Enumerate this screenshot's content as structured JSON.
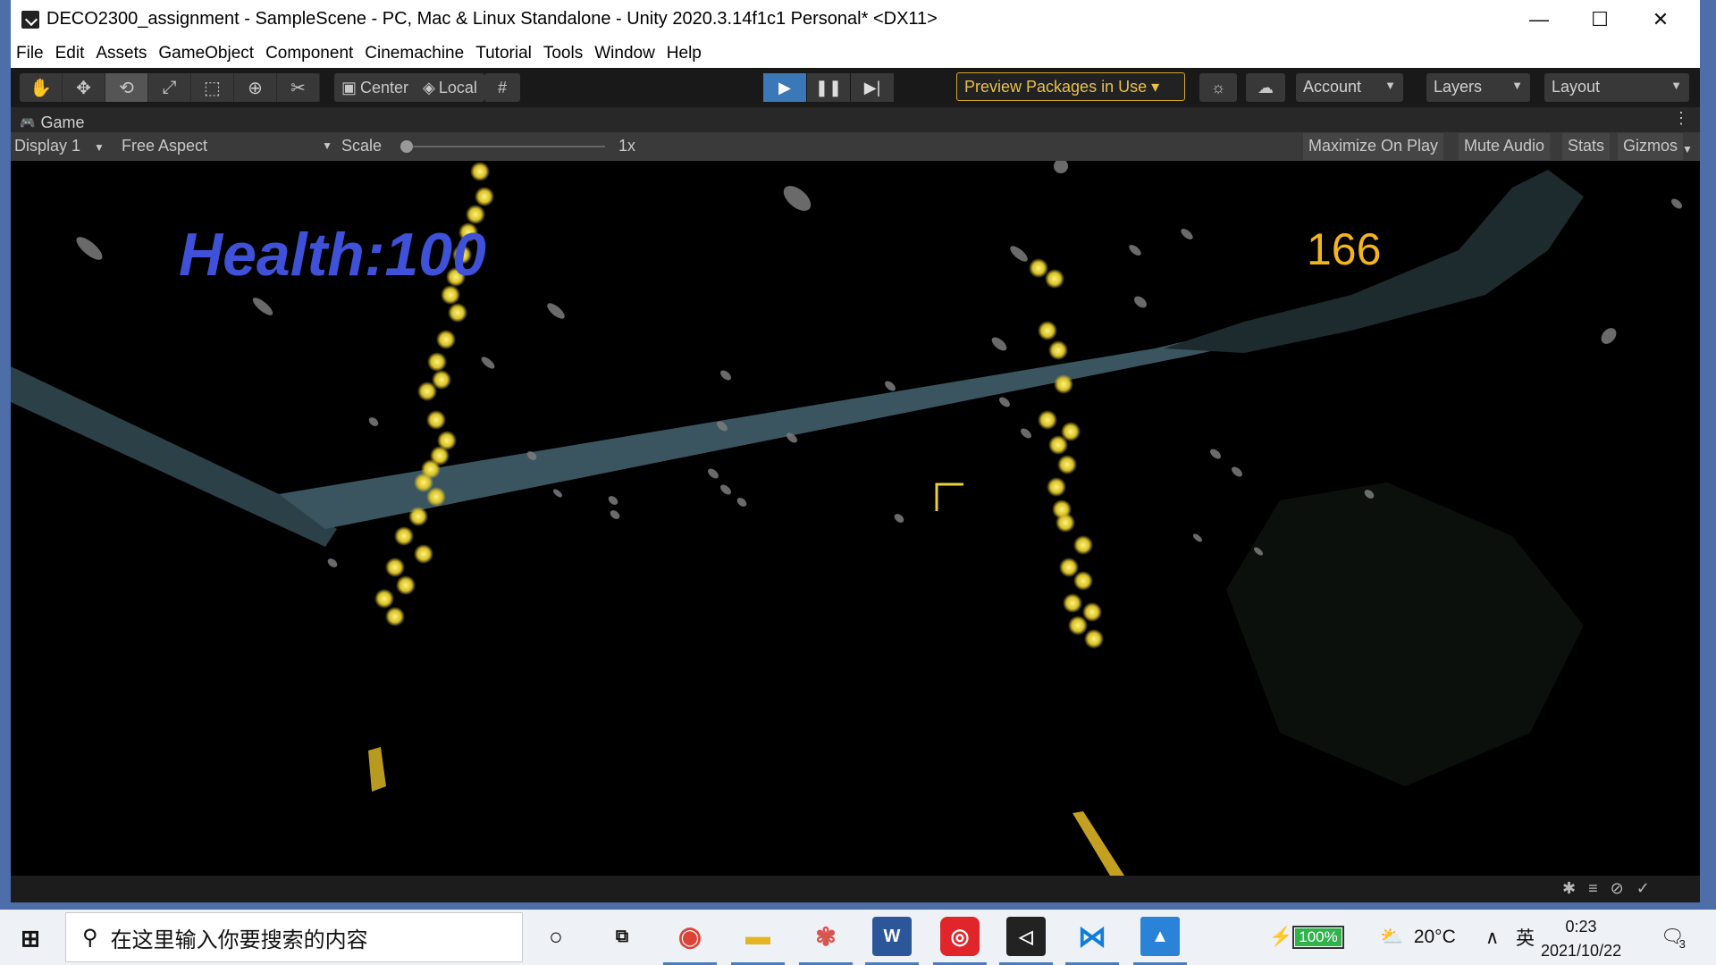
{
  "window": {
    "title": "DECO2300_assignment - SampleScene - PC, Mac & Linux Standalone - Unity 2020.3.14f1c1 Personal* <DX11>",
    "controls": {
      "minimize": "—",
      "maximize": "☐",
      "close": "✕"
    }
  },
  "menu": [
    "File",
    "Edit",
    "Assets",
    "GameObject",
    "Component",
    "Cinemachine",
    "Tutorial",
    "Tools",
    "Window",
    "Help"
  ],
  "toolbar": {
    "tools": [
      "hand-icon",
      "move-icon",
      "rotate-icon",
      "scale-icon",
      "rect-icon",
      "transform-icon",
      "custom-tool-icon"
    ],
    "pivot_label": "Center",
    "space_label": "Local",
    "preview_packages": "Preview Packages in Use",
    "account": "Account",
    "layers": "Layers",
    "layout": "Layout",
    "play_state": "playing"
  },
  "game_tab": {
    "label": "Game",
    "display": "Display 1",
    "aspect": "Free Aspect",
    "scale_label": "Scale",
    "scale_value": "1x",
    "maximize_on_play": "Maximize On Play",
    "mute_audio": "Mute Audio",
    "stats": "Stats",
    "gizmos": "Gizmos"
  },
  "hud": {
    "health_text": "Health:100",
    "score": "166"
  },
  "taskbar": {
    "search_placeholder": "在这里输入你要搜索的内容",
    "battery": "100%",
    "weather": "20°C",
    "ime": "英",
    "time": "0:23",
    "date": "2021/10/22",
    "notifications": "3",
    "apps": [
      "chrome-icon",
      "file-explorer-icon",
      "network-app-icon",
      "word-icon",
      "netease-music-icon",
      "unity-icon",
      "vscode-icon",
      "photos-icon"
    ]
  },
  "colors": {
    "health": "#3f51d8",
    "score": "#f2b51a",
    "firefly": "#e8d23c",
    "beam": "#3a5560",
    "editor_bg": "#191919"
  }
}
